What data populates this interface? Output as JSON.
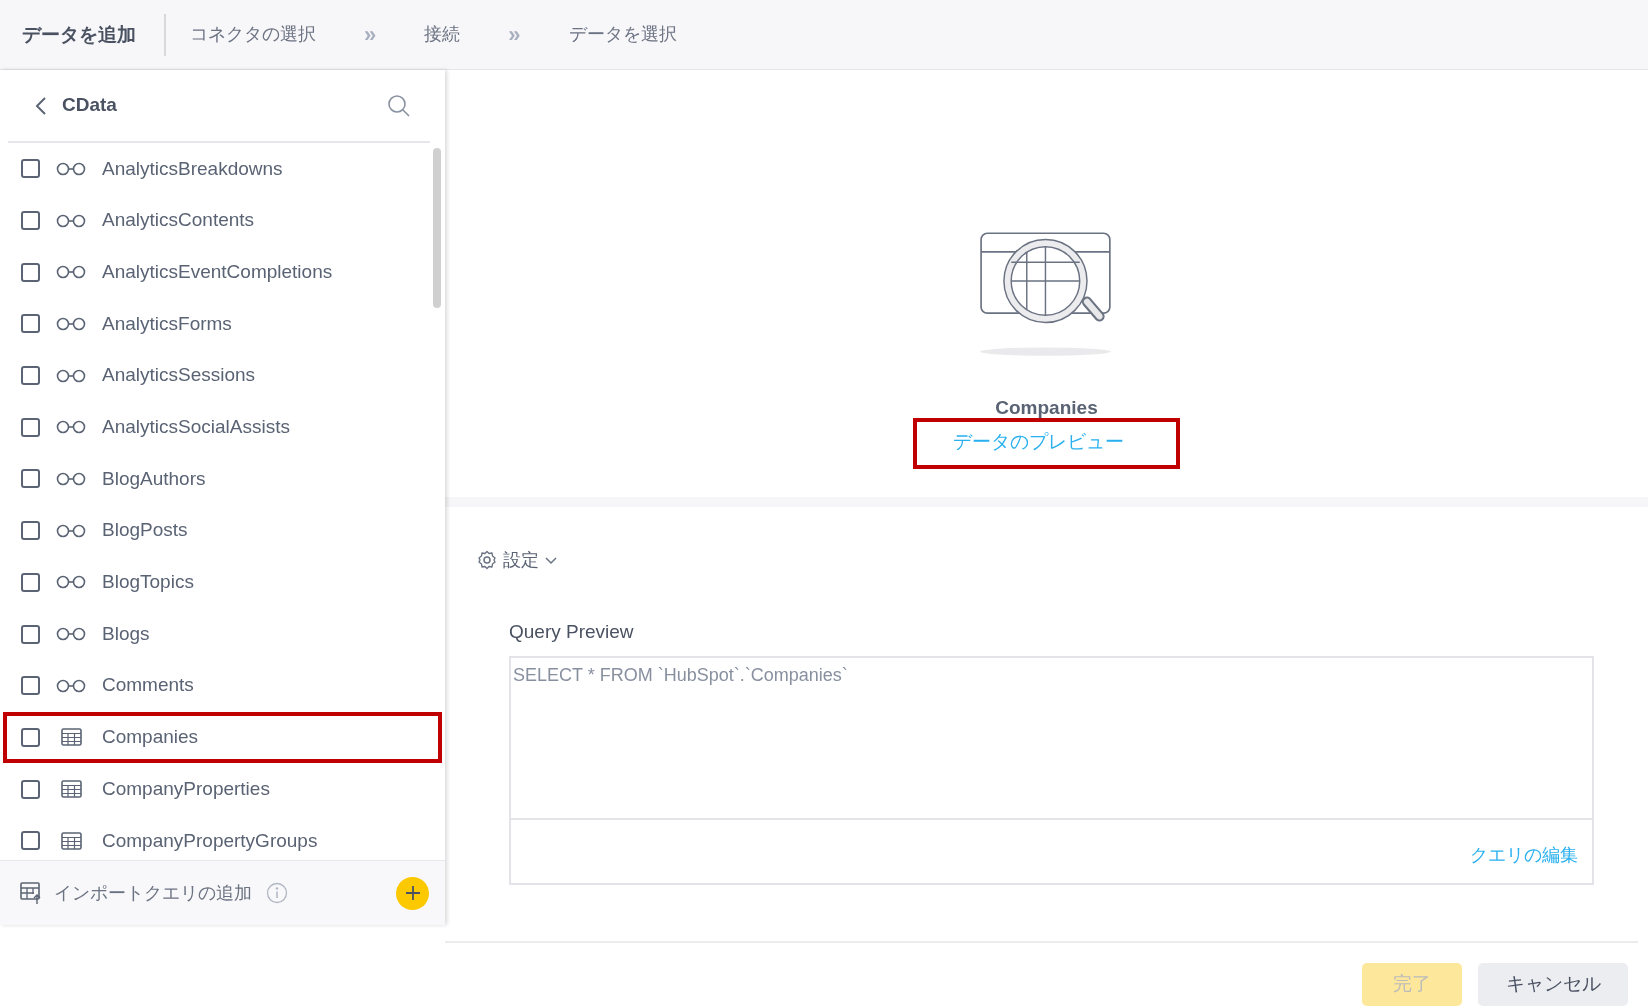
{
  "header": {
    "title": "データを追加",
    "steps": [
      {
        "label": "コネクタの選択",
        "kind": "step"
      },
      {
        "label": "»",
        "kind": "separator"
      },
      {
        "label": "接続",
        "kind": "step"
      },
      {
        "label": "»",
        "kind": "separator"
      },
      {
        "label": "データを選択",
        "kind": "step"
      }
    ]
  },
  "sidebar": {
    "title": "CData",
    "items": [
      {
        "label": "AnalyticsBreakdowns",
        "kind": "view",
        "checked": false,
        "highlighted": false
      },
      {
        "label": "AnalyticsContents",
        "kind": "view",
        "checked": false,
        "highlighted": false
      },
      {
        "label": "AnalyticsEventCompletions",
        "kind": "view",
        "checked": false,
        "highlighted": false
      },
      {
        "label": "AnalyticsForms",
        "kind": "view",
        "checked": false,
        "highlighted": false
      },
      {
        "label": "AnalyticsSessions",
        "kind": "view",
        "checked": false,
        "highlighted": false
      },
      {
        "label": "AnalyticsSocialAssists",
        "kind": "view",
        "checked": false,
        "highlighted": false
      },
      {
        "label": "BlogAuthors",
        "kind": "view",
        "checked": false,
        "highlighted": false
      },
      {
        "label": "BlogPosts",
        "kind": "view",
        "checked": false,
        "highlighted": false
      },
      {
        "label": "BlogTopics",
        "kind": "view",
        "checked": false,
        "highlighted": false
      },
      {
        "label": "Blogs",
        "kind": "view",
        "checked": false,
        "highlighted": false
      },
      {
        "label": "Comments",
        "kind": "view",
        "checked": false,
        "highlighted": false
      },
      {
        "label": "Companies",
        "kind": "table",
        "checked": false,
        "highlighted": true
      },
      {
        "label": "CompanyProperties",
        "kind": "table",
        "checked": false,
        "highlighted": false
      },
      {
        "label": "CompanyPropertyGroups",
        "kind": "table",
        "checked": false,
        "highlighted": false
      }
    ],
    "footer": {
      "label": "インポートクエリの追加"
    }
  },
  "preview": {
    "name": "Companies",
    "link": "データのプレビュー",
    "highlighted": true
  },
  "settings": {
    "label": "設定",
    "expanded": false
  },
  "query": {
    "label": "Query Preview",
    "value": "SELECT * FROM `HubSpot`.`Companies`",
    "edit_link": "クエリの編集"
  },
  "buttons": [
    {
      "label": "完了",
      "kind": "primary",
      "disabled": true
    },
    {
      "label": "キャンセル",
      "kind": "secondary",
      "disabled": false
    }
  ]
}
